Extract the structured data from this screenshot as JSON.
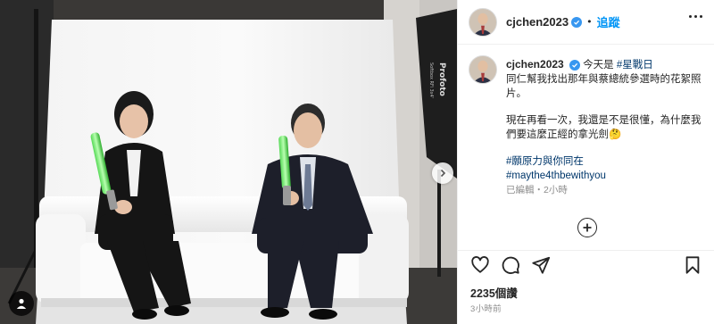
{
  "post": {
    "username": "cjchen2023",
    "follow_label": "追蹤",
    "separator": "•",
    "caption_lines": [
      "今天是",
      "#星戰日",
      "同仁幫我找出那年與蔡總統參選時的花絮照片。",
      "現在再看一次，我還是不是很懂，為什麼我們要這麼正經的拿光劍🤔",
      "#願原力與你同在",
      "#maythe4thbewithyou"
    ],
    "edited_meta": "已編輯・2小時",
    "likes": "2235個讚",
    "timestamp": "3小時前"
  },
  "photo": {
    "backdrop_brand": "Profoto",
    "backdrop_sub": "Softbox RFi 3x4'"
  },
  "icons": {
    "verified": "verified-badge-icon",
    "more": "more-options-icon",
    "tag": "user-tag-icon",
    "next": "chevron-right-icon",
    "load": "plus-circle-icon",
    "like": "heart-icon",
    "comment": "comment-icon",
    "share": "send-icon",
    "save": "bookmark-icon"
  },
  "colors": {
    "link": "#0095f6",
    "hashtag": "#00376b",
    "verified": "#3897f0",
    "muted": "#8e8e8e"
  }
}
